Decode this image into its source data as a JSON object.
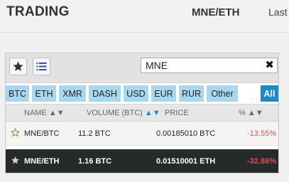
{
  "header": {
    "title": "TRADING",
    "pair": "MNE/ETH",
    "last_label": "Last"
  },
  "toolbar": {
    "favorites_icon": "star-icon",
    "list_icon": "list-icon",
    "search_value": "MNE",
    "clear_icon": "close-icon",
    "clear_glyph": "✖"
  },
  "filters": [
    "BTC",
    "ETH",
    "XMR",
    "DASH",
    "USD",
    "EUR",
    "RUR",
    "Other",
    "All"
  ],
  "filters_selected": "All",
  "table": {
    "columns": {
      "name": "NAME",
      "volume": "VOLUME (BTC)",
      "price": "PRICE",
      "change": "%",
      "sort_arrows": "▲▼"
    },
    "rows": [
      {
        "favorite": false,
        "name": "MNE/BTC",
        "volume": "11.2 BTC",
        "price": "0.00185010 BTC",
        "change": "-13.55%"
      },
      {
        "favorite": true,
        "name": "MNE/ETH",
        "volume": "1.16 BTC",
        "price": "0.01510001 ETH",
        "change": "-32.86%"
      }
    ]
  },
  "colors": {
    "accent": "#1d89c8",
    "chip": "#a9d7f0",
    "negative": "#d9534f",
    "selected_row": "#262a2b"
  }
}
